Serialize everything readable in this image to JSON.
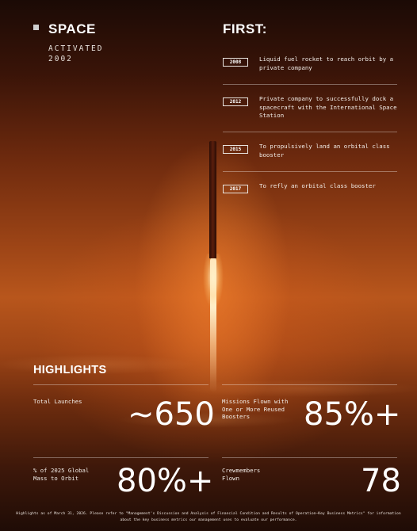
{
  "header": {
    "brand": "SPACE",
    "activated_label": "ACTIVATED",
    "activated_year": "2002",
    "first_title": "FIRST:"
  },
  "firsts": [
    {
      "year": "2008",
      "text": "Liquid fuel rocket to reach orbit by a private company"
    },
    {
      "year": "2012",
      "text": "Private company to successfully dock a spacecraft with the International Space Station"
    },
    {
      "year": "2015",
      "text": "To propulsively land an orbital class booster"
    },
    {
      "year": "2017",
      "text": "To refly an orbital class booster"
    }
  ],
  "highlights": {
    "title": "HIGHLIGHTS",
    "total_launches": {
      "label": "Total Launches",
      "value": "~650"
    },
    "reused": {
      "label": "Missions Flown with One or More Reused Boosters",
      "value": "85%+"
    },
    "mass": {
      "label": "% of 2025 Global Mass to Orbit",
      "value": "80%+"
    },
    "crew": {
      "label": "Crewmembers Flown",
      "value": "78"
    }
  },
  "footnote": "Highlights as of March 31, 2026. Please refer to \"Management's Discussion and Analysis of Financial Condition and Results of Operation—Key Business Metrics\" for information about the key business metrics our management uses to evaluate our performance."
}
